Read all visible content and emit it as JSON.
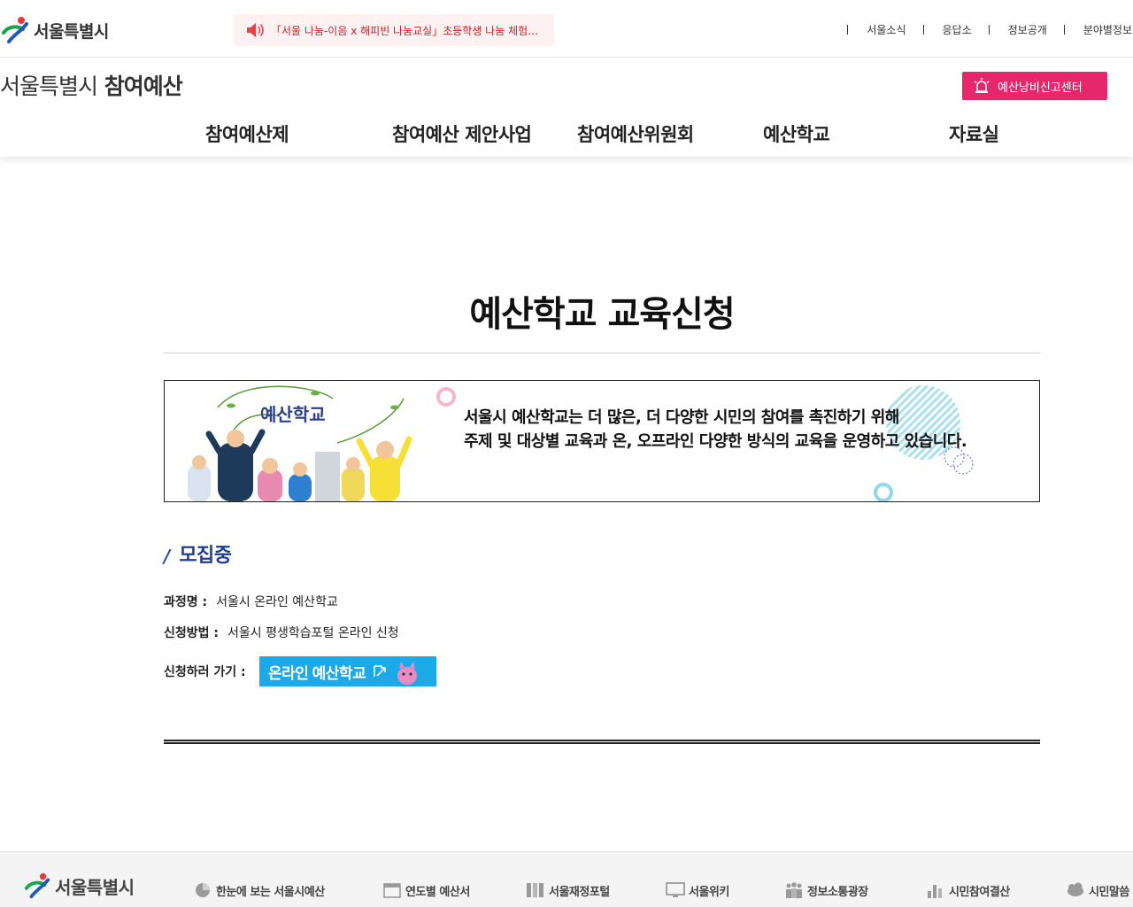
{
  "header": {
    "logo_text": "서울특별시",
    "notice": "「서울 나눔-이음 x 해피빈 나눔교실」초등학생 나눔 체험교...",
    "util_links": [
      "서울소식",
      "응답소",
      "정보공개",
      "분야별정보"
    ],
    "site_title_main": "서울특별시",
    "site_title_sub": "참여예산",
    "report_button": "예산낭비신고센터"
  },
  "nav": {
    "items": [
      "참여예산제",
      "참여예산 제안사업",
      "참여예산위원회",
      "예산학교",
      "자료실"
    ]
  },
  "main": {
    "page_title": "예산학교 교육신청",
    "banner_art_title": "예산학교",
    "banner_line1": "서울시 예산학교는 더 많은, 더 다양한 시민의 참여를 촉진하기 위해",
    "banner_line2": "주제 및 대상별 교육과 온, 오프라인 다양한 방식의 교육을 운영하고 있습니다.",
    "recruit_title": "모집중",
    "course_label": "과정명 :",
    "course_value": "서울시 온라인 예산학교",
    "method_label": "신청방법 :",
    "method_value": "서울시 평생학습포털 온라인 신청",
    "apply_label": "신청하러 가기 :",
    "apply_button": "온라인 예산학교"
  },
  "footer": {
    "logo_text": "서울특별시",
    "items": [
      "한눈에 보는 서울시예산",
      "연도별 예산서",
      "서울재정포털",
      "서울위키",
      "정보소통광장",
      "시민참여결산",
      "시민말씀"
    ]
  },
  "colors": {
    "accent_pink": "#e6276b",
    "notice_red": "#c0262c",
    "recruit_blue": "#1f3f8f",
    "apply_blue": "#1ba9e8"
  }
}
